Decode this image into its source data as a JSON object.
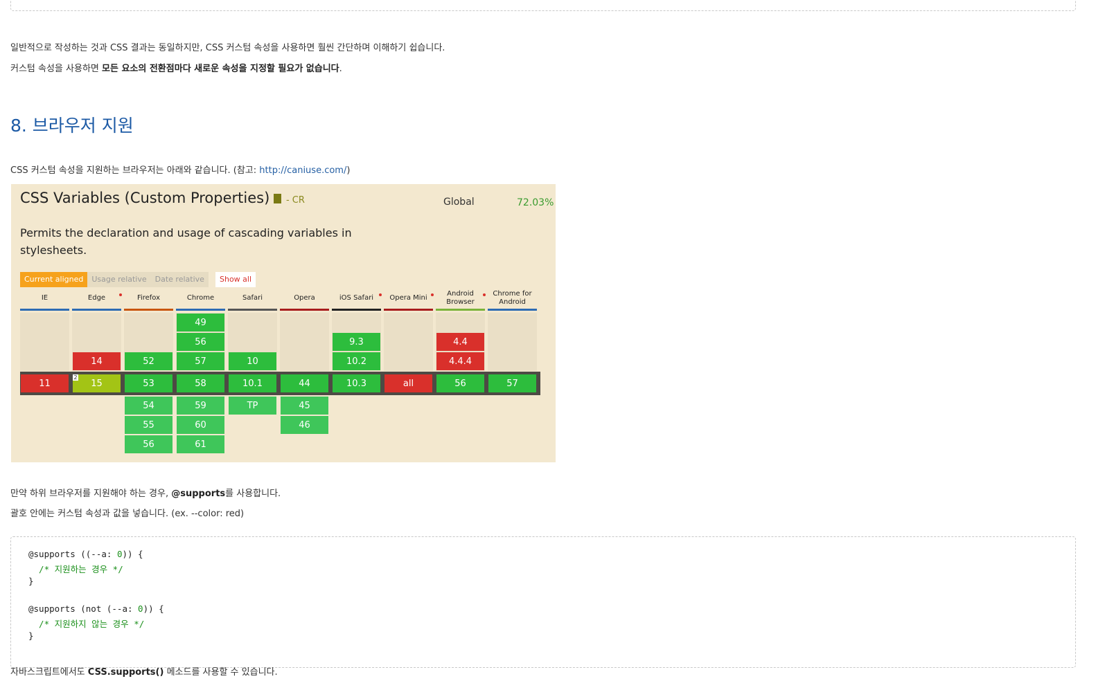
{
  "paragraphs": {
    "p1": "일반적으로 작성하는 것과 CSS 결과는 동일하지만, CSS 커스텀 속성을 사용하면 훨씬 간단하며 이해하기 쉽습니다.",
    "p2_pre": "커스텀 속성을 사용하면 ",
    "p2_bold": "모든 요소의 전환점마다 새로운 속성을 지정할 필요가 없습니다",
    "p2_post": ".",
    "heading": "8. 브라우저 지원",
    "p3_pre": "CSS 커스텀 속성을 지원하는 브라우저는 아래와 같습니다. (참고: ",
    "p3_link": "http://caniuse.com/",
    "p3_post": ")",
    "p4_pre": "만약 하위 브라우저를 지원해야 하는 경우, ",
    "p4_bold": "@supports",
    "p4_post": "를 사용합니다.",
    "p5": "괄호 안에는 커스텀 속성과 값을 넣습니다. (ex. --color: red)",
    "p6_pre": "자바스크립트에서도 ",
    "p6_bold": "CSS.supports()",
    "p6_post": " 메소드를 사용할 수 있습니다."
  },
  "caniuse": {
    "title": "CSS Variables (Custom Properties)",
    "status": "- CR",
    "global_label": "Global",
    "global_pct": "72.03%",
    "description": "Permits the declaration and usage of cascading variables in stylesheets.",
    "tabs": [
      "Current aligned",
      "Usage relative",
      "Date relative"
    ],
    "show_all": "Show all",
    "browsers": [
      {
        "name": "IE",
        "bar": "#2d6bb3",
        "above": [],
        "current": {
          "v": "11",
          "s": "r"
        },
        "below": []
      },
      {
        "name": "Edge",
        "bar": "#2d6bb3",
        "above": [
          {
            "v": "14",
            "s": "r"
          }
        ],
        "current": {
          "v": "15",
          "s": "o",
          "note": "2"
        },
        "below": []
      },
      {
        "name": "Firefox",
        "bar": "#c8560f",
        "above": [
          {
            "v": "52",
            "s": "g"
          }
        ],
        "current": {
          "v": "53",
          "s": "g"
        },
        "below": [
          {
            "v": "54",
            "s": "lg"
          },
          {
            "v": "55",
            "s": "lg"
          },
          {
            "v": "56",
            "s": "lg"
          }
        ]
      },
      {
        "name": "Chrome",
        "bar": "#2d6bb3",
        "above": [
          {
            "v": "49",
            "s": "g"
          },
          {
            "v": "56",
            "s": "g"
          },
          {
            "v": "57",
            "s": "g"
          }
        ],
        "current": {
          "v": "58",
          "s": "g"
        },
        "below": [
          {
            "v": "59",
            "s": "lg"
          },
          {
            "v": "60",
            "s": "lg"
          },
          {
            "v": "61",
            "s": "lg"
          }
        ]
      },
      {
        "name": "Safari",
        "bar": "#555555",
        "above": [
          {
            "v": "10",
            "s": "g"
          }
        ],
        "current": {
          "v": "10.1",
          "s": "g"
        },
        "below": [
          {
            "v": "TP",
            "s": "lg"
          }
        ]
      },
      {
        "name": "Opera",
        "bar": "#a81d1d",
        "above": [],
        "current": {
          "v": "44",
          "s": "g"
        },
        "below": [
          {
            "v": "45",
            "s": "lg"
          },
          {
            "v": "46",
            "s": "lg"
          }
        ]
      },
      {
        "name": "iOS Safari",
        "bar": "#222222",
        "above": [
          {
            "v": "9.3",
            "s": "g"
          },
          {
            "v": "10.2",
            "s": "g"
          }
        ],
        "current": {
          "v": "10.3",
          "s": "g"
        },
        "below": []
      },
      {
        "name": "Opera Mini",
        "bar": "#a81d1d",
        "above": [],
        "current": {
          "v": "all",
          "s": "r"
        },
        "below": []
      },
      {
        "name": "Android Browser",
        "bar": "#7ab33a",
        "above": [
          {
            "v": "4.4",
            "s": "r"
          },
          {
            "v": "4.4.4",
            "s": "r"
          }
        ],
        "current": {
          "v": "56",
          "s": "g"
        },
        "below": []
      },
      {
        "name": "Chrome for Android",
        "bar": "#2d6bb3",
        "above": [],
        "current": {
          "v": "57",
          "s": "g"
        },
        "below": []
      }
    ]
  },
  "code": {
    "l1a": "@supports ((--a: ",
    "l1n": "0",
    "l1b": ")) {",
    "l2": "  /* 지원하는 경우 */",
    "l3": "}",
    "l5a": "@supports (not (--a: ",
    "l5n": "0",
    "l5b": ")) {",
    "l6": "  /* 지원하지 않는 경우 */",
    "l7": "}"
  }
}
